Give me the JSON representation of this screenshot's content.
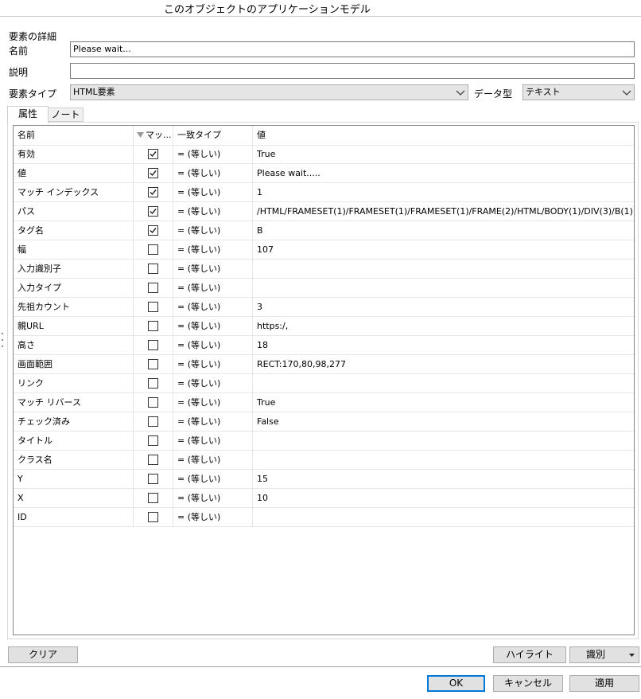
{
  "window": {
    "title": "このオブジェクトのアプリケーションモデル"
  },
  "details": {
    "section_label": "要素の詳細",
    "name_label": "名前",
    "name_value": "Please wait...",
    "description_label": "説明",
    "description_value": "",
    "element_type_label": "要素タイプ",
    "element_type_value": "HTML要素",
    "data_type_label": "データ型",
    "data_type_value": "テキスト"
  },
  "tabs": [
    {
      "label": "属性"
    },
    {
      "label": "ノート"
    }
  ],
  "grid": {
    "columns": {
      "name": "名前",
      "match": "マッ...",
      "match_type": "一致タイプ",
      "value": "値"
    },
    "rows": [
      {
        "name": "有効",
        "checked": true,
        "match_type": "= (等しい)",
        "value": "True"
      },
      {
        "name": "値",
        "checked": true,
        "match_type": "= (等しい)",
        "value": "Please wait....."
      },
      {
        "name": "マッチ インデックス",
        "checked": true,
        "match_type": "= (等しい)",
        "value": "1"
      },
      {
        "name": "パス",
        "checked": true,
        "match_type": "= (等しい)",
        "value": "/HTML/FRAMESET(1)/FRAMESET(1)/FRAMESET(1)/FRAME(2)/HTML/BODY(1)/DIV(3)/B(1)"
      },
      {
        "name": "タグ名",
        "checked": true,
        "match_type": "= (等しい)",
        "value": "B"
      },
      {
        "name": "幅",
        "checked": false,
        "match_type": "= (等しい)",
        "value": "107"
      },
      {
        "name": "入力識別子",
        "checked": false,
        "match_type": "= (等しい)",
        "value": ""
      },
      {
        "name": "入力タイプ",
        "checked": false,
        "match_type": "= (等しい)",
        "value": ""
      },
      {
        "name": "先祖カウント",
        "checked": false,
        "match_type": "= (等しい)",
        "value": "3"
      },
      {
        "name": "親URL",
        "checked": false,
        "match_type": "= (等しい)",
        "value": "https:/,"
      },
      {
        "name": "高さ",
        "checked": false,
        "match_type": "= (等しい)",
        "value": "18"
      },
      {
        "name": "画面範囲",
        "checked": false,
        "match_type": "= (等しい)",
        "value": "RECT:170,80,98,277"
      },
      {
        "name": "リンク",
        "checked": false,
        "match_type": "= (等しい)",
        "value": ""
      },
      {
        "name": "マッチ リバース",
        "checked": false,
        "match_type": "= (等しい)",
        "value": "True"
      },
      {
        "name": "チェック済み",
        "checked": false,
        "match_type": "= (等しい)",
        "value": "False"
      },
      {
        "name": "タイトル",
        "checked": false,
        "match_type": "= (等しい)",
        "value": ""
      },
      {
        "name": "クラス名",
        "checked": false,
        "match_type": "= (等しい)",
        "value": ""
      },
      {
        "name": "Y",
        "checked": false,
        "match_type": "= (等しい)",
        "value": "15"
      },
      {
        "name": "X",
        "checked": false,
        "match_type": "= (等しい)",
        "value": "10"
      },
      {
        "name": "ID",
        "checked": false,
        "match_type": "= (等しい)",
        "value": ""
      }
    ]
  },
  "buttons": {
    "clear": "クリア",
    "highlight": "ハイライト",
    "identify": "識別",
    "ok": "OK",
    "cancel": "キャンセル",
    "apply": "適用"
  },
  "colors": {
    "default_button_border": "#0078d7",
    "combo_bg": "#e5e5e5",
    "button_bg": "#e1e1e1"
  },
  "icons": {
    "dropdown": "chevron-down-icon",
    "checkbox_checked": "checkmark-icon",
    "sort": "sort-triangle-icon"
  }
}
